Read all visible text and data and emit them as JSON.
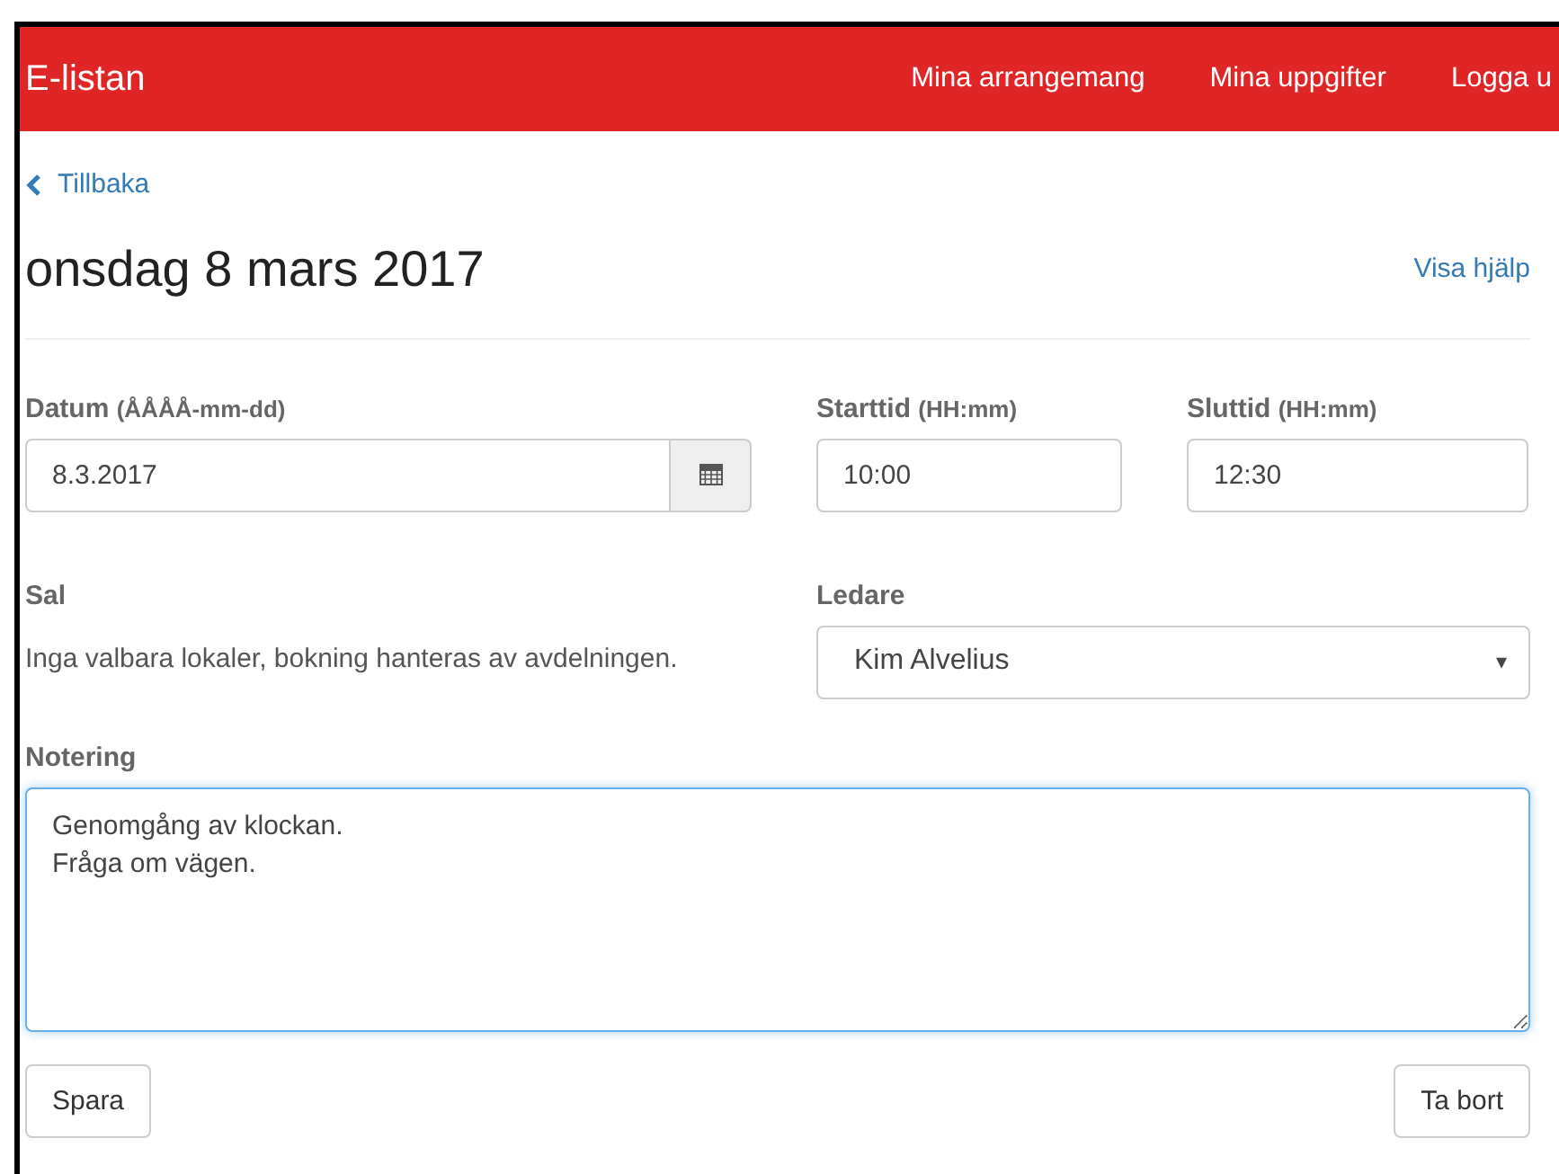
{
  "navbar": {
    "brand": "E-listan",
    "links": [
      {
        "label": "Mina arrangemang"
      },
      {
        "label": "Mina uppgifter"
      },
      {
        "label": "Logga u"
      }
    ]
  },
  "back_link": "Tillbaka",
  "title": "onsdag 8 mars 2017",
  "help_link": "Visa hjälp",
  "date": {
    "label": "Datum",
    "hint": "(ÅÅÅÅ-mm-dd)",
    "value": "8.3.2017"
  },
  "start": {
    "label": "Starttid",
    "hint": "(HH:mm)",
    "value": "10:00"
  },
  "end": {
    "label": "Sluttid",
    "hint": "(HH:mm)",
    "value": "12:30"
  },
  "room": {
    "label": "Sal",
    "text": "Inga valbara lokaler, bokning hanteras av avdelningen."
  },
  "leader": {
    "label": "Ledare",
    "value": "Kim Alvelius",
    "caret": "▾"
  },
  "note": {
    "label": "Notering",
    "value": "Genomgång av klockan.\nFråga om vägen.",
    "focused": true
  },
  "buttons": {
    "save": "Spara",
    "delete": "Ta bort"
  }
}
